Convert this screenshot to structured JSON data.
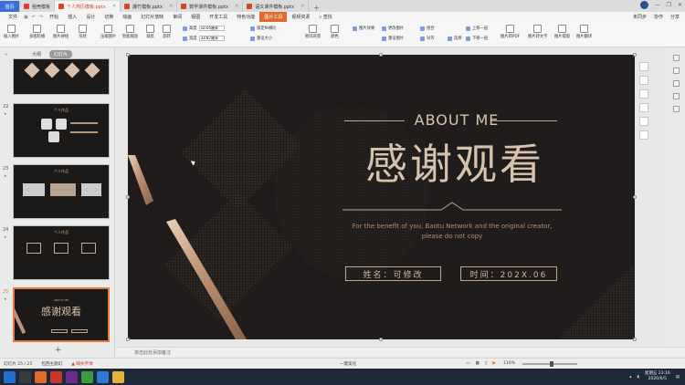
{
  "tabs": [
    {
      "label": "首页",
      "kind": "home"
    },
    {
      "label": "稻壳模板",
      "kind": "wps"
    },
    {
      "label": "个人简历模板.pptx",
      "kind": "ppt",
      "active": true
    },
    {
      "label": "爆竹模板.pptx",
      "kind": "ppt"
    },
    {
      "label": "数学课件模板.pptx",
      "kind": "ppt"
    },
    {
      "label": "语文课件模板.pptx",
      "kind": "ppt"
    }
  ],
  "menu": {
    "file": "文件",
    "items": [
      "开始",
      "插入",
      "设计",
      "切换",
      "动画",
      "幻灯片放映",
      "审阅",
      "视图",
      "开发工具",
      "特色功能",
      "图片工具",
      "视频资源"
    ],
    "highlight": "图片工具",
    "search": "查找",
    "sync": "未同步",
    "collab": "协作",
    "share": "分享"
  },
  "ribbon": {
    "insert_picture": "插入图片",
    "multi_picture": "多图轮播",
    "picture_split": "图片拼接",
    "shape": "形状",
    "compress": "压缩图片",
    "smart_crop": "智能缩放",
    "crop": "裁剪",
    "rotate": "旋转",
    "height_label": "高度",
    "height_value": "10.05厘米",
    "width_label": "宽度",
    "width_value": "33.87厘米",
    "lock_ratio": "锁定纵横比",
    "reset_size": "重设大小",
    "remove_bg": "抠除背景",
    "color": "颜色",
    "effects": "图片效果",
    "change_pic": "更改图片",
    "reset_pic": "重设图片",
    "combine": "组合",
    "align": "对齐",
    "select": "选择",
    "bring_forward": "上移一层",
    "send_backward": "下移一层",
    "to_pdf": "图片转PDF",
    "to_text": "图片转文字",
    "extract": "图片提取",
    "translate": "图片翻译"
  },
  "sidebar": {
    "tab_outline": "大纲",
    "tab_slides": "幻灯片",
    "slides": [
      {
        "num": "21",
        "title": ""
      },
      {
        "num": "22",
        "title": "个人作品"
      },
      {
        "num": "23",
        "title": "个人作品"
      },
      {
        "num": "24",
        "title": "个人作品"
      },
      {
        "num": "25",
        "title": "感谢观看",
        "selected": true
      }
    ],
    "add": "+"
  },
  "slide": {
    "about": "ABOUT ME",
    "title": "感谢观看",
    "english_1": "For the benefit of you, Baotu Network and the original creator,",
    "english_2": "please do not copy",
    "name_box": "姓名：可修改",
    "time_box": "时间：202X.06"
  },
  "notes": "单击此处添加备注",
  "status": {
    "slide_count": "幻灯片 25 / 25",
    "theme": "包西主题幻",
    "font_missing": "缺失字体",
    "notes_btn": "一键美化",
    "zoom": "110%"
  },
  "taskbar": {
    "time": "星期五 23:16",
    "date": "2020/6/5"
  },
  "colors": {
    "accent": "#e06a2a",
    "slide_bg": "#1f1c1b",
    "gold": "#c3a387",
    "home_tab": "#3a6fd8"
  }
}
